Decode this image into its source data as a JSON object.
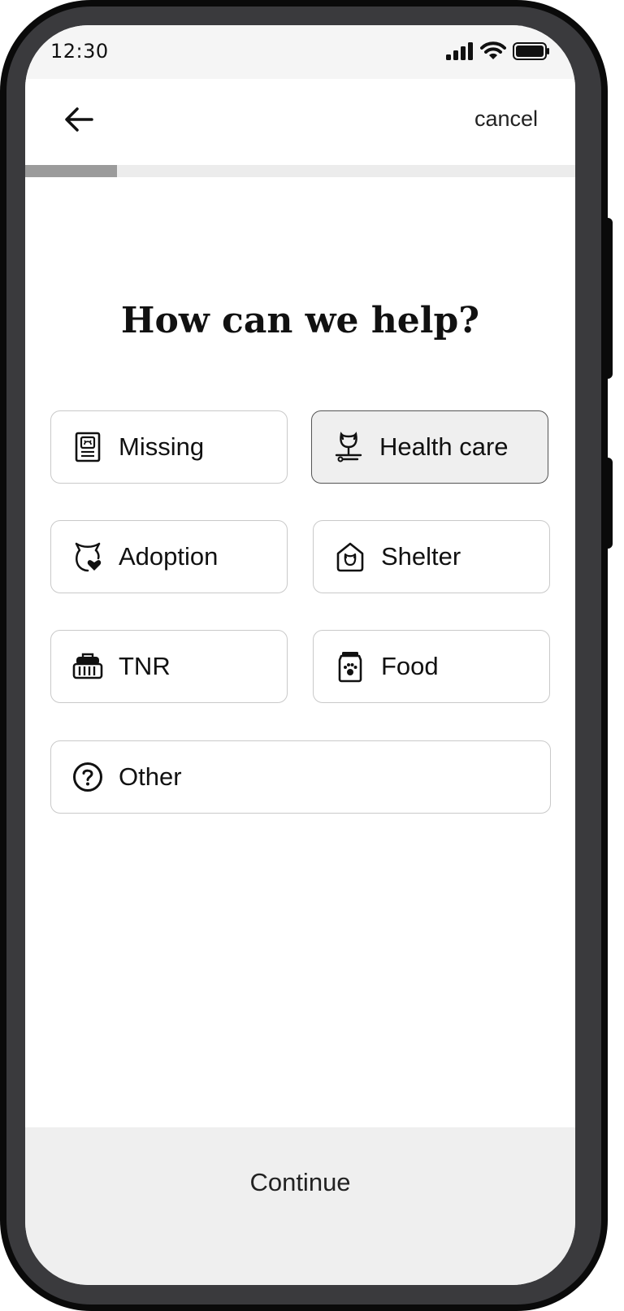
{
  "status_bar": {
    "time": "12:30",
    "icons": [
      "cellular-signal-icon",
      "wifi-icon",
      "battery-icon"
    ]
  },
  "nav": {
    "back_icon": "arrow-left-icon",
    "cancel_label": "cancel"
  },
  "progress": {
    "fraction": 0.167
  },
  "main": {
    "title": "How can we help?",
    "options": [
      {
        "id": "missing",
        "label": "Missing",
        "icon": "missing-poster-icon",
        "selected": false
      },
      {
        "id": "health",
        "label": "Health care",
        "icon": "pet-health-icon",
        "selected": true
      },
      {
        "id": "adoption",
        "label": "Adoption",
        "icon": "cat-heart-icon",
        "selected": false
      },
      {
        "id": "shelter",
        "label": "Shelter",
        "icon": "pet-house-icon",
        "selected": false
      },
      {
        "id": "tnr",
        "label": "TNR",
        "icon": "pet-carrier-icon",
        "selected": false
      },
      {
        "id": "food",
        "label": "Food",
        "icon": "pet-food-bag-icon",
        "selected": false
      },
      {
        "id": "other",
        "label": "Other",
        "icon": "question-circle-icon",
        "selected": false
      }
    ]
  },
  "footer": {
    "continue_label": "Continue"
  },
  "colors": {
    "selected_bg": "#efefef",
    "border": "#c9c9c9",
    "progress_fill": "#9b9b9b",
    "progress_track": "#ececec",
    "footer_bg": "#efefef"
  }
}
